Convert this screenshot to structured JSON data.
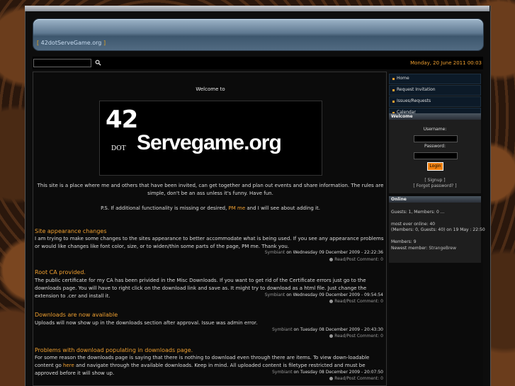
{
  "header": {
    "site_title": "42dotServeGame.org",
    "bracket_open": "[",
    "bracket_close": "]"
  },
  "toolbar": {
    "search_value": "",
    "date": "Monday, 20 June 2011 00:03"
  },
  "welcome": {
    "title": "Welcome to",
    "logo": {
      "number": "42",
      "dot": "DOT",
      "name": "Servegame.org"
    },
    "intro": "This site is a place where me and others that have been invited, can get together and plan out events and share information.  The rules are simple, don't be an ass unless it's funny.  Have fun.",
    "ps_before": "P.S. If additional functionality is missing or desired, ",
    "ps_link": "PM me",
    "ps_after": " and I will see about adding it."
  },
  "news": [
    {
      "title": "Site appearance changes",
      "body": "I am trying to make some changes to the sites appearance to better accommodate what is being used. If you see any appearance problems or would like changes like font color, size, or to widen/thin some parts of the page, PM me. Thank you.",
      "author": "Symbiant",
      "on": "on",
      "date": "Wednesday 09 December 2009 - 22:22:36",
      "read": "Read/Post Comment: 0"
    },
    {
      "title": "Root CA provided.",
      "body": "The public certificate for my CA has been privided in the Misc Downloads. If you want to get rid of the Certificate errors just go to the downloads page. You will have to right click on the download link and save as. It might try to download as a html file. Just change the extension to .cer and install it.",
      "author": "Symbiant",
      "on": "on",
      "date": "Wednesday 09 December 2009 - 09:54:54",
      "read": "Read/Post Comment: 0"
    },
    {
      "title": "Downloads are now available",
      "body": "Uploads will now show up in the downloads section after approval.  Issue was admin error.",
      "author": "Symbiant",
      "on": "on",
      "date": "Tuesday 08 December 2009 - 20:43:30",
      "read": "Read/Post Comment: 0"
    },
    {
      "title": "Problems with download populating in downloads page.",
      "body_before": "For some reason the downloads page is saying that there is nothing to download even through there are items. To view down-loadable content go ",
      "body_link": "here",
      "body_after": " and navigate through the available downloads. Keep in mind. All uploaded content is filetype restricted and must be approved before it will show up.",
      "author": "Symbiant",
      "on": "on",
      "date": "Tuesday 08 December 2009 - 20:07:50",
      "read": "Read/Post Comment: 0"
    }
  ],
  "sidebar": {
    "nav": [
      "Home",
      "Request Invitation",
      "Issues/Requests",
      "Calendar"
    ],
    "welcome_head": "Welcome",
    "username_label": "Username:",
    "password_label": "Password:",
    "login_label": "Login",
    "signup": "[ Signup ]",
    "forgot": "[ Forgot password? ]",
    "online_head": "Online",
    "guests_line": "Guests: 1, Members: 0 ...",
    "most_ever_line1": "most ever online: 40",
    "most_ever_line2": "(Members: 0, Guests: 40) on 19 May : 22:50",
    "members_line": "Members: 9",
    "newest_label": "Newest member: ",
    "newest_name": "StrangeBrew"
  },
  "colors": {
    "accent": "#f0a030",
    "banner": "#5e7890",
    "background": "#0d0d0d"
  }
}
